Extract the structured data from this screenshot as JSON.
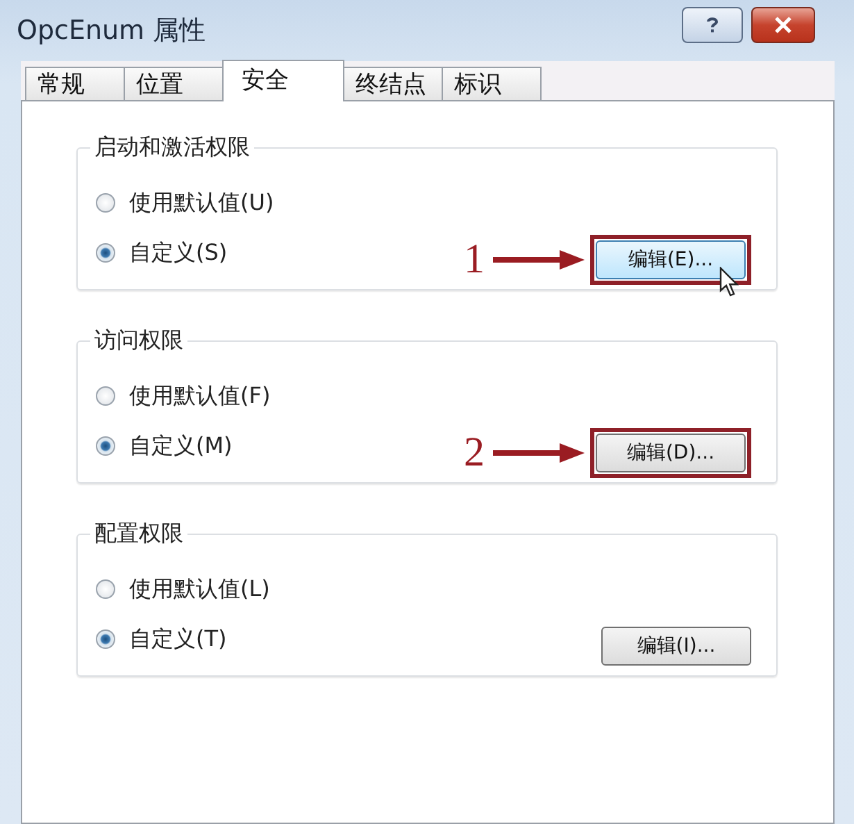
{
  "window": {
    "title": "OpcEnum 属性",
    "buttons": [
      {
        "kind": "help"
      },
      {
        "kind": "close"
      }
    ]
  },
  "tabs": [
    {
      "label": "常规",
      "selected": false
    },
    {
      "label": "位置",
      "selected": false
    },
    {
      "label": "安全",
      "selected": true
    },
    {
      "label": "终结点",
      "selected": false
    },
    {
      "label": "标识",
      "selected": false
    }
  ],
  "groups": [
    {
      "title": "启动和激活权限",
      "options": [
        {
          "label": "使用默认值(U)",
          "selected": false
        },
        {
          "label": "自定义(S)",
          "selected": true
        }
      ],
      "button": {
        "label": "编辑(E)...",
        "highlighted": true,
        "hovered": true,
        "pointer": true
      },
      "annotation": "1"
    },
    {
      "title": "访问权限",
      "options": [
        {
          "label": "使用默认值(F)",
          "selected": false
        },
        {
          "label": "自定义(M)",
          "selected": true
        }
      ],
      "button": {
        "label": "编辑(D)...",
        "highlighted": true,
        "hovered": false,
        "pointer": false
      },
      "annotation": "2"
    },
    {
      "title": "配置权限",
      "options": [
        {
          "label": "使用默认值(L)",
          "selected": false
        },
        {
          "label": "自定义(T)",
          "selected": true
        }
      ],
      "button": {
        "label": "编辑(I)...",
        "highlighted": false,
        "hovered": false,
        "pointer": false
      }
    }
  ]
}
